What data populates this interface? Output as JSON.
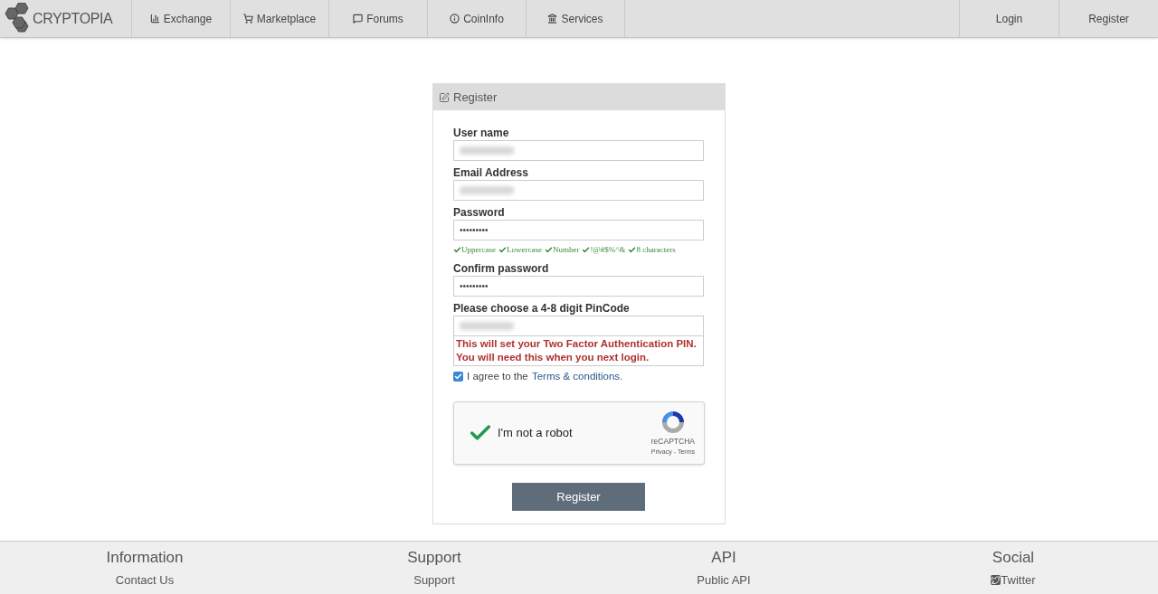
{
  "nav": {
    "logo": "CRYPTOPIA",
    "items": [
      {
        "label": "Exchange"
      },
      {
        "label": "Marketplace"
      },
      {
        "label": "Forums"
      },
      {
        "label": "CoinInfo"
      },
      {
        "label": "Services"
      }
    ],
    "account": [
      {
        "label": "Login"
      },
      {
        "label": "Register"
      }
    ]
  },
  "form": {
    "title": "Register",
    "fields": [
      {
        "label": "User name",
        "value_hidden": true
      },
      {
        "label": "Email Address",
        "value_hidden": true
      },
      {
        "label": "Password",
        "value": "•••••••••",
        "checks": [
          {
            "label": "Uppercase",
            "checked": true
          },
          {
            "label": "Lowercase",
            "checked": true
          },
          {
            "label": "Number",
            "checked": true
          },
          {
            "label": "!@#$%^&",
            "checked": true
          },
          {
            "label": "8 characters",
            "checked": true
          }
        ]
      },
      {
        "label": "Confirm password",
        "value": "•••••••••"
      },
      {
        "label": "Please choose a 4-8 digit PinCode",
        "value_hidden": true,
        "warning": [
          "This will set your Two Factor Authentication PIN.",
          "You will need this when you next login."
        ]
      }
    ],
    "agree": {
      "checked": true,
      "text": "I agree to the ",
      "link": "Terms & conditions."
    },
    "captcha": {
      "checked": true,
      "label": "I'm not a robot",
      "brand": "reCAPTCHA",
      "privacy": "Privacy",
      "separator": " - ",
      "terms": "Terms"
    },
    "submit": "Register"
  },
  "footer": [
    {
      "heading": "Information",
      "link": "Contact Us"
    },
    {
      "heading": "Support",
      "link": "Support"
    },
    {
      "heading": "API",
      "link": "Public API"
    },
    {
      "heading": "Social",
      "link": "Twitter"
    }
  ]
}
